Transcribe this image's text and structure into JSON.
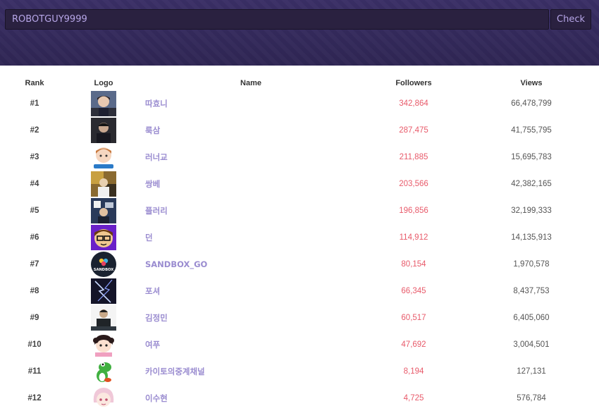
{
  "search": {
    "value": "ROBOTGUY9999",
    "button_label": "Check"
  },
  "table": {
    "headers": {
      "rank": "Rank",
      "logo": "Logo",
      "name": "Name",
      "followers": "Followers",
      "views": "Views"
    },
    "rows": [
      {
        "rank": "#1",
        "name": "따효니",
        "followers": "342,864",
        "views": "66,478,799",
        "logo": "avatar-photo-1"
      },
      {
        "rank": "#2",
        "name": "룩삼",
        "followers": "287,475",
        "views": "41,755,795",
        "logo": "avatar-photo-2"
      },
      {
        "rank": "#3",
        "name": "러너교",
        "followers": "211,885",
        "views": "15,695,783",
        "logo": "avatar-cartoon-runner"
      },
      {
        "rank": "#4",
        "name": "쌍베",
        "followers": "203,566",
        "views": "42,382,165",
        "logo": "avatar-photo-3"
      },
      {
        "rank": "#5",
        "name": "플러리",
        "followers": "196,856",
        "views": "32,199,333",
        "logo": "avatar-photo-4"
      },
      {
        "rank": "#6",
        "name": "던",
        "followers": "114,912",
        "views": "14,135,913",
        "logo": "avatar-cartoon-glasses"
      },
      {
        "rank": "#7",
        "name": "SANDBOX_GO",
        "followers": "80,154",
        "views": "1,970,578",
        "logo": "avatar-sandbox"
      },
      {
        "rank": "#8",
        "name": "포셔",
        "followers": "66,345",
        "views": "8,437,753",
        "logo": "avatar-lightning"
      },
      {
        "rank": "#9",
        "name": "김정민",
        "followers": "60,517",
        "views": "6,405,060",
        "logo": "avatar-photo-5"
      },
      {
        "rank": "#10",
        "name": "여푸",
        "followers": "47,692",
        "views": "3,004,501",
        "logo": "avatar-cartoon-girl"
      },
      {
        "rank": "#11",
        "name": "카이토의중계채널",
        "followers": "8,194",
        "views": "127,131",
        "logo": "avatar-yoshi"
      },
      {
        "rank": "#12",
        "name": "이수현",
        "followers": "4,725",
        "views": "576,784",
        "logo": "avatar-cartoon-pink"
      }
    ]
  },
  "colors": {
    "header_bg": "#342a5c",
    "accent_name": "#9a8cd0",
    "followers": "#e85a6a"
  },
  "sandbox_logo_text": "SANDBOX"
}
